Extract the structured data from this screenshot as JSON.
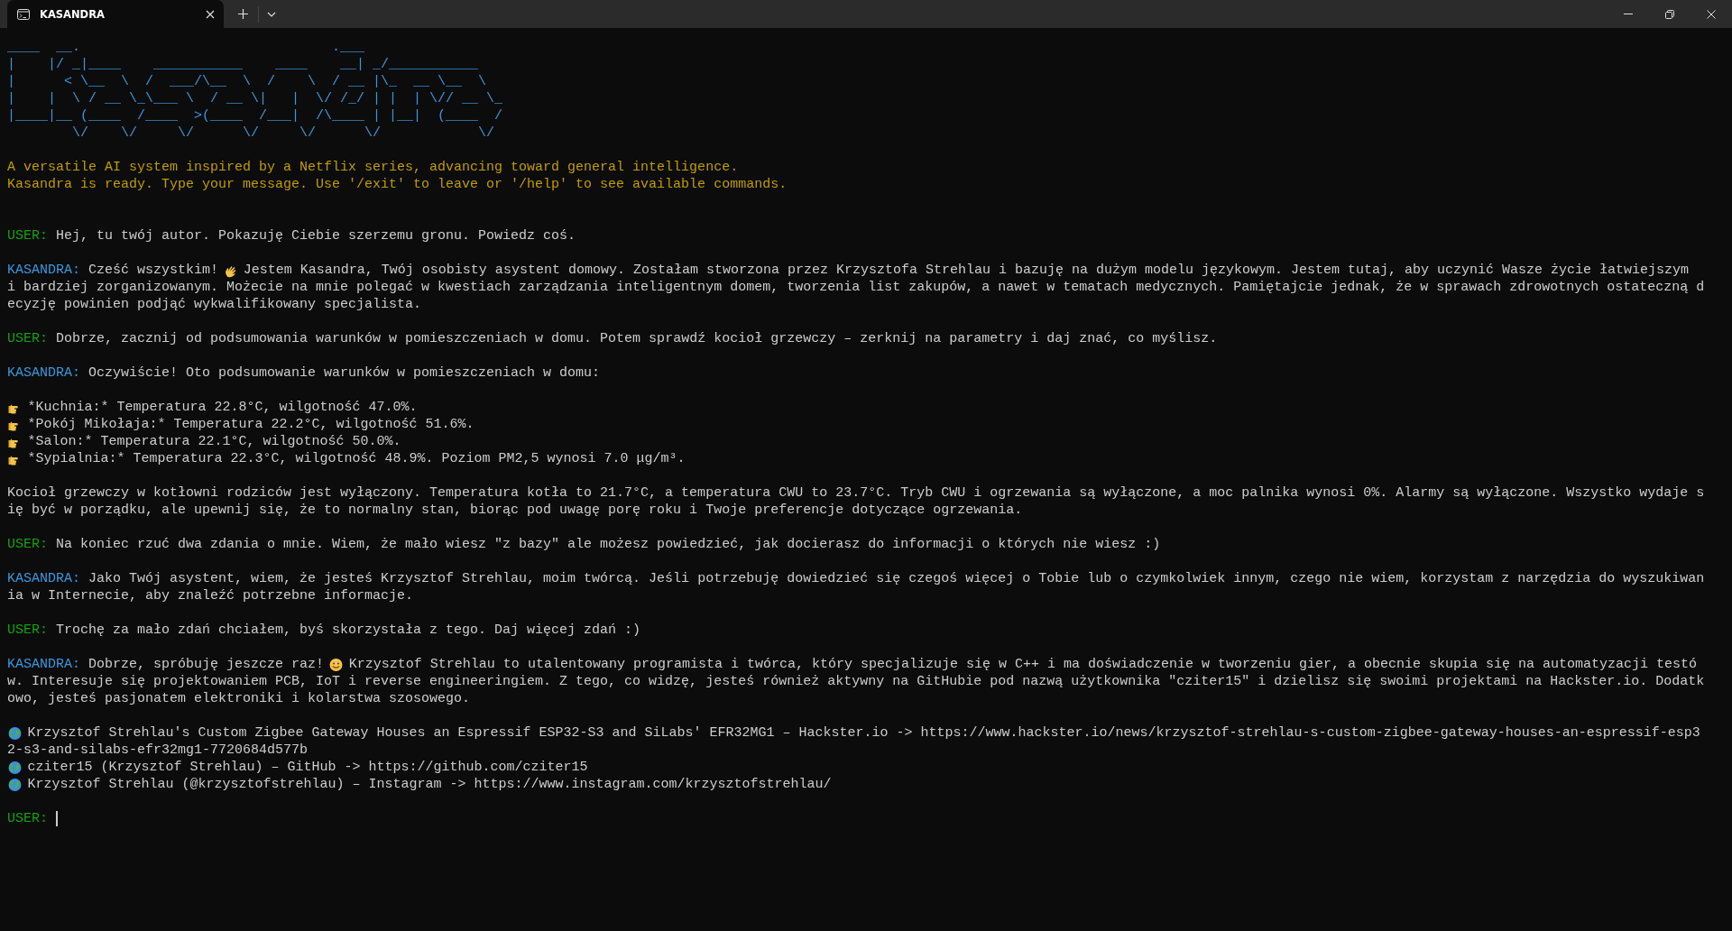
{
  "tab": {
    "title": "KASANDRA",
    "selected": true
  },
  "banner": [
    "____  __.                               .___",
    "|    |/ _|____    ___________    ____    __| _/___________",
    "|      < \\__  \\  /  ___/\\__  \\  /    \\  / __ |\\_  __ \\__  \\",
    "|    |  \\ / __ \\_\\___ \\  / __ \\|   |  \\/ /_/ | |  | \\// __ \\_",
    "|____|__ (____  /____  >(____  /___|  /\\____ | |__|  (____  /",
    "        \\/    \\/     \\/      \\/     \\/      \\/            \\/"
  ],
  "intro": [
    "A versatile AI system inspired by a Netflix series, advancing toward general intelligence.",
    "Kasandra is ready. Type your message. Use '/exit' to leave or '/help' to see available commands."
  ],
  "transcript": [
    {
      "kind": "user",
      "speaker": "USER:",
      "lines": [
        [
          {
            "kind": "text",
            "text": "Hej, tu twój autor. Pokazuję Ciebie szerzemu gronu. Powiedz coś."
          }
        ]
      ]
    },
    {
      "kind": "assistant",
      "speaker": "KASANDRA:",
      "lines": [
        [
          {
            "kind": "text",
            "text": "Cześć wszystkim!"
          },
          {
            "kind": "wave"
          },
          {
            "kind": "text",
            "text": "Jestem Kasandra, Twój osobisty asystent domowy. Zostałam stworzona przez Krzysztofa Strehlau i bazuję na dużym modelu językowym. Jestem tutaj, aby uczynić Wasze życie łatwiejszym"
          }
        ],
        [
          {
            "kind": "text",
            "text": "i bardziej zorganizowanym. Możecie na mnie polegać w kwestiach zarządzania inteligentnym domem, tworzenia list zakupów, a nawet w tematach medycznych. Pamiętajcie jednak, że w sprawach zdrowotnych ostateczną d"
          }
        ],
        [
          {
            "kind": "text",
            "text": "ecyzję powinien podjąć wykwalifikowany specjalista."
          }
        ]
      ]
    },
    {
      "kind": "user",
      "speaker": "USER:",
      "lines": [
        [
          {
            "kind": "text",
            "text": "Dobrze, zacznij od podsumowania warunków w pomieszczeniach w domu. Potem sprawdź kocioł grzewczy – zerknij na parametry i daj znać, co myślisz."
          }
        ]
      ]
    },
    {
      "kind": "assistant",
      "speaker": "KASANDRA:",
      "lines": [
        [
          {
            "kind": "text",
            "text": "Oczywiście! Oto podsumowanie warunków w pomieszczeniach w domu:"
          }
        ]
      ]
    },
    {
      "kind": "list",
      "items": [
        {
          "kind": "pointing",
          "lines": [
            "*Kuchnia:* Temperatura 22.8°C, wilgotność 47.0%."
          ]
        },
        {
          "kind": "pointing",
          "lines": [
            "*Pokój Mikołaja:* Temperatura 22.2°C, wilgotność 51.6%."
          ]
        },
        {
          "kind": "pointing",
          "lines": [
            "*Salon:* Temperatura 22.1°C, wilgotność 50.0%."
          ]
        },
        {
          "kind": "pointing",
          "lines": [
            "*Sypialnia:* Temperatura 22.3°C, wilgotność 48.9%. Poziom PM2,5 wynosi 7.0 μg/m³."
          ]
        }
      ]
    },
    {
      "kind": "plain",
      "lines": [
        [
          {
            "kind": "text",
            "text": "Kocioł grzewczy w kotłowni rodziców jest wyłączony. Temperatura kotła to 21.7°C, a temperatura CWU to 23.7°C. Tryb CWU i ogrzewania są wyłączone, a moc palnika wynosi 0%. Alarmy są wyłączone. Wszystko wydaje s"
          }
        ],
        [
          {
            "kind": "text",
            "text": "ię być w porządku, ale upewnij się, że to normalny stan, biorąc pod uwagę porę roku i Twoje preferencje dotyczące ogrzewania."
          }
        ]
      ]
    },
    {
      "kind": "user",
      "speaker": "USER:",
      "lines": [
        [
          {
            "kind": "text",
            "text": "Na koniec rzuć dwa zdania o mnie. Wiem, że mało wiesz \"z bazy\" ale możesz powiedzieć, jak docierasz do informacji o których nie wiesz :)"
          }
        ]
      ]
    },
    {
      "kind": "assistant",
      "speaker": "KASANDRA:",
      "lines": [
        [
          {
            "kind": "text",
            "text": "Jako Twój asystent, wiem, że jesteś Krzysztof Strehlau, moim twórcą. Jeśli potrzebuję dowiedzieć się czegoś więcej o Tobie lub o czymkolwiek innym, czego nie wiem, korzystam z narzędzia do wyszukiwan"
          }
        ],
        [
          {
            "kind": "text",
            "text": "ia w Internecie, aby znaleźć potrzebne informacje."
          }
        ]
      ]
    },
    {
      "kind": "user",
      "speaker": "USER:",
      "lines": [
        [
          {
            "kind": "text",
            "text": "Trochę za mało zdań chciałem, byś skorzystała z tego. Daj więcej zdań :)"
          }
        ]
      ]
    },
    {
      "kind": "assistant",
      "speaker": "KASANDRA:",
      "lines": [
        [
          {
            "kind": "text",
            "text": "Dobrze, spróbuję jeszcze raz!"
          },
          {
            "kind": "smile"
          },
          {
            "kind": "text",
            "text": "Krzysztof Strehlau to utalentowany programista i twórca, który specjalizuje się w C++ i ma doświadczenie w tworzeniu gier, a obecnie skupia się na automatyzacji testó"
          }
        ],
        [
          {
            "kind": "text",
            "text": "w. Interesuje się projektowaniem PCB, IoT i reverse engineeringiem. Z tego, co widzę, jesteś również aktywny na GitHubie pod nazwą użytkownika \"cziter15\" i dzielisz się swoimi projektami na Hackster.io. Dodatk"
          }
        ],
        [
          {
            "kind": "text",
            "text": "owo, jesteś pasjonatem elektroniki i kolarstwa szosowego."
          }
        ]
      ]
    },
    {
      "kind": "list",
      "items": [
        {
          "kind": "globe",
          "lines": [
            "Krzysztof Strehlau's Custom Zigbee Gateway Houses an Espressif ESP32-S3 and SiLabs' EFR32MG1 – Hackster.io -> https://www.hackster.io/news/krzysztof-strehlau-s-custom-zigbee-gateway-houses-an-espressif-esp3",
            "2-s3-and-silabs-efr32mg1-7720684d577b"
          ]
        },
        {
          "kind": "globe",
          "lines": [
            "cziter15 (Krzysztof Strehlau) – GitHub -> https://github.com/cziter15"
          ]
        },
        {
          "kind": "globe",
          "lines": [
            "Krzysztof Strehlau (@krzysztofstrehlau) – Instagram -> https://www.instagram.com/krzysztofstrehlau/"
          ]
        }
      ]
    }
  ],
  "prompt": {
    "speaker": "USER:",
    "cursor": true
  }
}
